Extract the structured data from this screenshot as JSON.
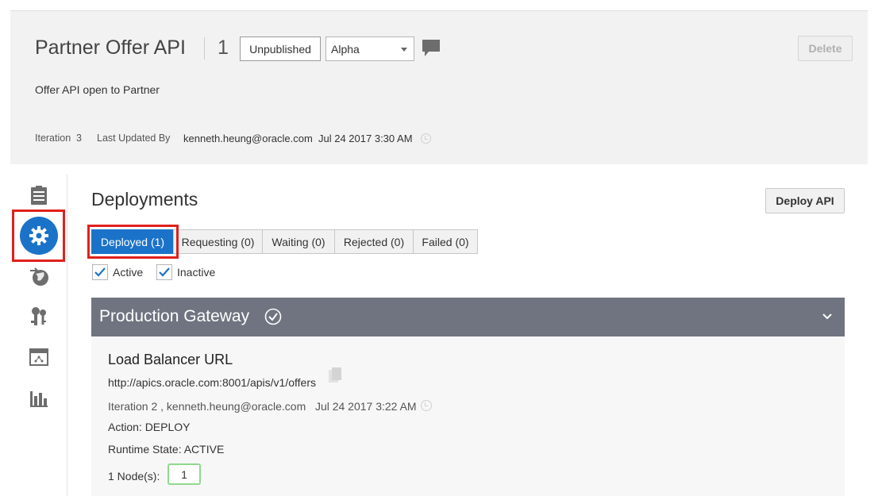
{
  "header": {
    "api_name": "Partner Offer API",
    "version": "1",
    "state_label": "Unpublished",
    "stage_select": "Alpha",
    "delete_label": "Delete",
    "description": "Offer API open to Partner",
    "iteration_label": "Iteration",
    "iteration_value": "3",
    "last_updated_label": "Last Updated By",
    "last_updated_user": "kenneth.heung@oracle.com",
    "last_updated_time": "Jul 24 2017 3:30 AM"
  },
  "sidebar": {
    "items": [
      {
        "name": "overview",
        "icon": "document-icon"
      },
      {
        "name": "deployments",
        "icon": "gear-icon",
        "active": true
      },
      {
        "name": "publication",
        "icon": "globe-icon"
      },
      {
        "name": "grants",
        "icon": "keys-icon"
      },
      {
        "name": "api-implementation",
        "icon": "window-icon"
      },
      {
        "name": "analytics",
        "icon": "bar-chart-icon"
      }
    ]
  },
  "main": {
    "title": "Deployments",
    "deploy_button": "Deploy API",
    "tabs": [
      {
        "label": "Deployed (1)",
        "active": true
      },
      {
        "label": "Requesting (0)"
      },
      {
        "label": "Waiting (0)"
      },
      {
        "label": "Rejected (0)"
      },
      {
        "label": "Failed (0)"
      }
    ],
    "filters": [
      {
        "label": "Active",
        "checked": true
      },
      {
        "label": "Inactive",
        "checked": true
      }
    ],
    "gateway": {
      "name": "Production Gateway",
      "lb_title": "Load Balancer URL",
      "lb_url": "http://apics.oracle.com:8001/apis/v1/offers",
      "iteration_info": "Iteration 2 , kenneth.heung@oracle.com",
      "iteration_time": "Jul 24 2017 3:22 AM",
      "action": "Action: DEPLOY",
      "runtime_state": "Runtime State: ACTIVE",
      "nodes_label": "1 Node(s):",
      "nodes_value": "1"
    }
  },
  "colors": {
    "accent": "#1b73c9",
    "highlight": "#e0201b",
    "gateway_bar": "#6f7480",
    "nodes_border": "#8fd88f"
  }
}
